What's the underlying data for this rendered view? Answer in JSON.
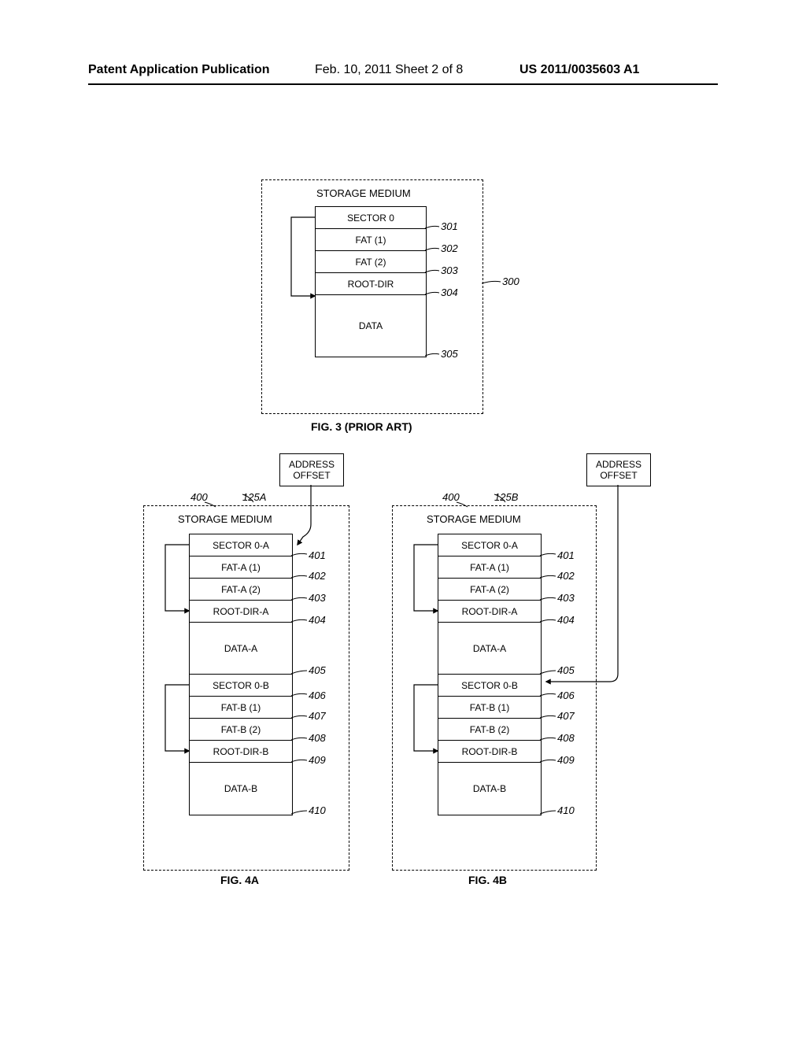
{
  "header": {
    "left": "Patent Application Publication",
    "center": "Feb. 10, 2011  Sheet 2 of 8",
    "right": "US 2011/0035603 A1"
  },
  "fig3": {
    "caption": "FIG. 3 (PRIOR ART)",
    "storage_label": "STORAGE MEDIUM",
    "rows": {
      "r1": "SECTOR 0",
      "r2": "FAT (1)",
      "r3": "FAT (2)",
      "r4": "ROOT-DIR",
      "r5": "DATA"
    },
    "refs": {
      "n300": "300",
      "n301": "301",
      "n302": "302",
      "n303": "303",
      "n304": "304",
      "n305": "305"
    }
  },
  "fig4a": {
    "caption": "FIG. 4A",
    "addr_offset": "ADDRESS\nOFFSET",
    "storage_label": "STORAGE MEDIUM",
    "rows": {
      "r1": "SECTOR 0-A",
      "r2": "FAT-A (1)",
      "r3": "FAT-A (2)",
      "r4": "ROOT-DIR-A",
      "r5": "DATA-A",
      "r6": "SECTOR 0-B",
      "r7": "FAT-B (1)",
      "r8": "FAT-B (2)",
      "r9": "ROOT-DIR-B",
      "r10": "DATA-B"
    },
    "refs": {
      "n125A": "125A",
      "n400": "400",
      "n401": "401",
      "n402": "402",
      "n403": "403",
      "n404": "404",
      "n405": "405",
      "n406": "406",
      "n407": "407",
      "n408": "408",
      "n409": "409",
      "n410": "410"
    }
  },
  "fig4b": {
    "caption": "FIG. 4B",
    "addr_offset": "ADDRESS\nOFFSET",
    "storage_label": "STORAGE MEDIUM",
    "rows": {
      "r1": "SECTOR 0-A",
      "r2": "FAT-A (1)",
      "r3": "FAT-A (2)",
      "r4": "ROOT-DIR-A",
      "r5": "DATA-A",
      "r6": "SECTOR 0-B",
      "r7": "FAT-B (1)",
      "r8": "FAT-B (2)",
      "r9": "ROOT-DIR-B",
      "r10": "DATA-B"
    },
    "refs": {
      "n125B": "125B",
      "n400": "400",
      "n401": "401",
      "n402": "402",
      "n403": "403",
      "n404": "404",
      "n405": "405",
      "n406": "406",
      "n407": "407",
      "n408": "408",
      "n409": "409",
      "n410": "410"
    }
  }
}
